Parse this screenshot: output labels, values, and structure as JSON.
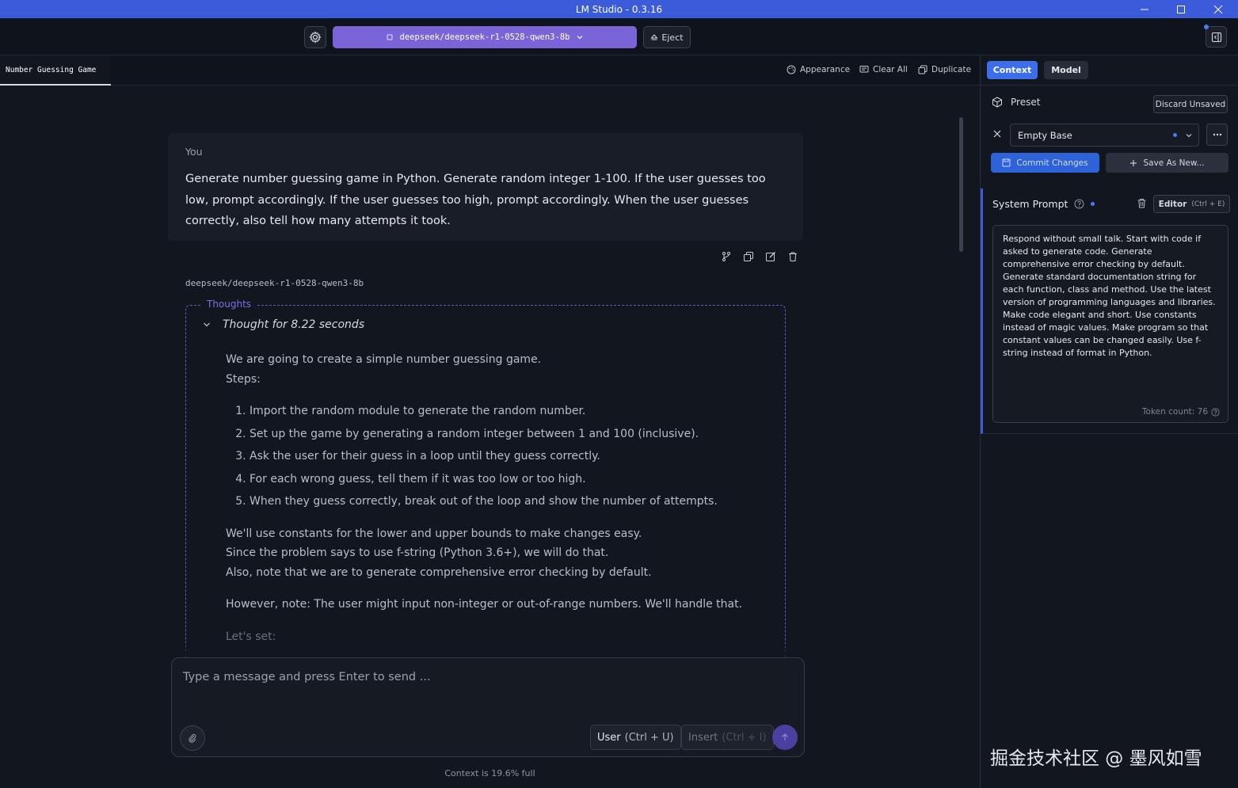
{
  "window": {
    "title": "LM Studio - 0.3.16",
    "minimize_icon": "minimize-icon",
    "maximize_icon": "maximize-icon",
    "close_icon": "close-icon"
  },
  "topbar": {
    "settings_icon": "gear-icon",
    "model_selector": "deepseek/deepseek-r1-0528-qwen3-8b",
    "eject_label": "Eject",
    "panel_icon": "sidebar-toggle-icon"
  },
  "tabbar": {
    "tabs": [
      {
        "label": "Number Guessing Game"
      }
    ],
    "appearance_label": "Appearance",
    "clear_all_label": "Clear All",
    "duplicate_label": "Duplicate"
  },
  "chat": {
    "user_message": {
      "sender": "You",
      "text": "Generate number guessing game in Python. Generate random integer 1-100. If the user guesses too low, prompt accordingly. If the user guesses too high, prompt accordingly. When the user guesses correctly, also tell how many attempts it took."
    },
    "assistant": {
      "model_name": "deepseek/deepseek-r1-0528-qwen3-8b",
      "thoughts_label": "Thoughts",
      "thought_summary": "Thought for 8.22 seconds",
      "intro": [
        "We are going to create a simple number guessing game.",
        "Steps:"
      ],
      "steps": [
        "Import the random module to generate the random number.",
        "Set up the game by generating a random integer between 1 and 100 (inclusive).",
        "Ask the user for their guess in a loop until they guess correctly.",
        "For each wrong guess, tell them if it was too low or too high.",
        "When they guess correctly, break out of the loop and show the number of attempts."
      ],
      "paragraph1": [
        "We'll use constants for the lower and upper bounds to make changes easy.",
        "Since the problem says to use f-string (Python 3.6+), we will do that.",
        "Also, note that we are to generate comprehensive error checking by default."
      ],
      "paragraph2": "However, note: The user might input non-integer or out-of-range numbers. We'll handle that.",
      "paragraph3": "Let's set:"
    }
  },
  "composer": {
    "placeholder": "Type a message and press Enter to send ...",
    "user_label": "User",
    "user_shortcut": "(Ctrl + U)",
    "insert_label": "Insert",
    "insert_shortcut": "(Ctrl + I)",
    "context_status": "Context is 19.6% full"
  },
  "sidebar": {
    "tabs": {
      "context": "Context",
      "model": "Model"
    },
    "preset_label": "Preset",
    "discard_label": "Discard Unsaved",
    "preset_value": "Empty Base",
    "commit_label": "Commit Changes",
    "save_as_label": "Save As New...",
    "system_prompt_label": "System Prompt",
    "editor_label": "Editor",
    "editor_shortcut": "(Ctrl + E)",
    "system_prompt_text": "Respond without small talk. Start with code if asked to generate code. Generate comprehensive error checking by default. Generate standard documentation string for each function, class and method. Use the latest version of programming languages and libraries. Make code elegant and short. Use constants instead of magic values. Make program so that constant values can be changed easily. Use f-string instead of format in Python.",
    "token_count": "Token count: 76"
  },
  "watermark": "掘金技术社区 @ 墨风如雪",
  "colors": {
    "accent": "#3b5bdb",
    "model_button": "#7b64d8",
    "thoughts_border": "#5a5fc0",
    "background": "#12161f"
  }
}
